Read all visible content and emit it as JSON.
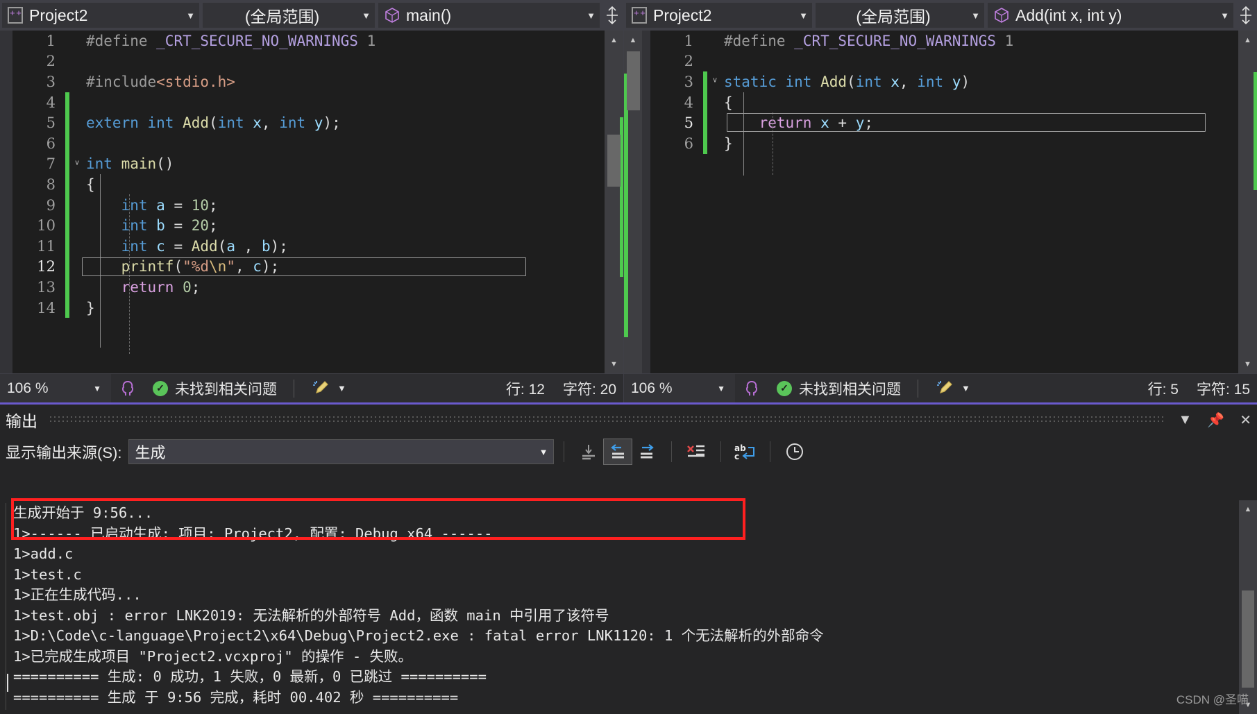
{
  "app": {
    "watermark": "CSDN @圣喵"
  },
  "editor_left": {
    "nav": {
      "project": "Project2",
      "scope": "(全局范围)",
      "function": "main()",
      "project_icon": "project-icon",
      "function_icon": "cube-icon"
    },
    "lines": [
      {
        "n": "1",
        "tokens": [
          {
            "t": "#define ",
            "c": "c-pre"
          },
          {
            "t": "_CRT_SECURE_NO_WARNINGS",
            "c": "c-macro"
          },
          {
            "t": " 1",
            "c": "c-pre"
          }
        ],
        "indent": 0
      },
      {
        "n": "2",
        "tokens": [],
        "indent": 0
      },
      {
        "n": "3",
        "tokens": [
          {
            "t": "#include",
            "c": "c-pre"
          },
          {
            "t": "<stdio.h>",
            "c": "c-hdr"
          }
        ],
        "indent": 0
      },
      {
        "n": "4",
        "tokens": [],
        "indent": 0
      },
      {
        "n": "5",
        "tokens": [
          {
            "t": "extern ",
            "c": "c-kw"
          },
          {
            "t": "int ",
            "c": "c-kw"
          },
          {
            "t": "Add",
            "c": "c-fn"
          },
          {
            "t": "(",
            "c": "c-punct"
          },
          {
            "t": "int ",
            "c": "c-kw"
          },
          {
            "t": "x",
            "c": "c-var"
          },
          {
            "t": ", ",
            "c": "c-punct"
          },
          {
            "t": "int ",
            "c": "c-kw"
          },
          {
            "t": "y",
            "c": "c-var"
          },
          {
            "t": ");",
            "c": "c-punct"
          }
        ],
        "indent": 0
      },
      {
        "n": "6",
        "tokens": [],
        "indent": 0
      },
      {
        "n": "7",
        "tokens": [
          {
            "t": "int ",
            "c": "c-kw"
          },
          {
            "t": "main",
            "c": "c-fn"
          },
          {
            "t": "()",
            "c": "c-punct"
          }
        ],
        "indent": 0
      },
      {
        "n": "8",
        "tokens": [
          {
            "t": "{",
            "c": "c-punct"
          }
        ],
        "indent": 0
      },
      {
        "n": "9",
        "tokens": [
          {
            "t": "int ",
            "c": "c-kw"
          },
          {
            "t": "a",
            "c": "c-var"
          },
          {
            "t": " = ",
            "c": "c-punct"
          },
          {
            "t": "10",
            "c": "c-num"
          },
          {
            "t": ";",
            "c": "c-punct"
          }
        ],
        "indent": 1
      },
      {
        "n": "10",
        "tokens": [
          {
            "t": "int ",
            "c": "c-kw"
          },
          {
            "t": "b",
            "c": "c-var"
          },
          {
            "t": " = ",
            "c": "c-punct"
          },
          {
            "t": "20",
            "c": "c-num"
          },
          {
            "t": ";",
            "c": "c-punct"
          }
        ],
        "indent": 1
      },
      {
        "n": "11",
        "tokens": [
          {
            "t": "int ",
            "c": "c-kw"
          },
          {
            "t": "c",
            "c": "c-var"
          },
          {
            "t": " = ",
            "c": "c-punct"
          },
          {
            "t": "Add",
            "c": "c-fn"
          },
          {
            "t": "(",
            "c": "c-punct"
          },
          {
            "t": "a",
            "c": "c-var"
          },
          {
            "t": " , ",
            "c": "c-punct"
          },
          {
            "t": "b",
            "c": "c-var"
          },
          {
            "t": ");",
            "c": "c-punct"
          }
        ],
        "indent": 1
      },
      {
        "n": "12",
        "tokens": [
          {
            "t": "printf",
            "c": "c-fn"
          },
          {
            "t": "(",
            "c": "c-punct"
          },
          {
            "t": "\"%d",
            "c": "c-str"
          },
          {
            "t": "\\n",
            "c": "c-esc"
          },
          {
            "t": "\"",
            "c": "c-str"
          },
          {
            "t": ", ",
            "c": "c-punct"
          },
          {
            "t": "c",
            "c": "c-var"
          },
          {
            "t": ");",
            "c": "c-punct"
          }
        ],
        "indent": 1
      },
      {
        "n": "13",
        "tokens": [
          {
            "t": "return ",
            "c": "c-kw2"
          },
          {
            "t": "0",
            "c": "c-num"
          },
          {
            "t": ";",
            "c": "c-punct"
          }
        ],
        "indent": 1
      },
      {
        "n": "14",
        "tokens": [
          {
            "t": "}",
            "c": "c-punct"
          }
        ],
        "indent": 0
      }
    ],
    "current_line_index": 11,
    "status": {
      "zoom": "106 %",
      "problems": "未找到相关问题",
      "line_label": "行: 12",
      "col_label": "字符: 20"
    }
  },
  "editor_right": {
    "nav": {
      "project": "Project2",
      "scope": "(全局范围)",
      "function": "Add(int x, int y)",
      "project_icon": "project-icon",
      "function_icon": "cube-icon"
    },
    "lines": [
      {
        "n": "1",
        "tokens": [
          {
            "t": "#define ",
            "c": "c-pre"
          },
          {
            "t": "_CRT_SECURE_NO_WARNINGS",
            "c": "c-macro"
          },
          {
            "t": " 1",
            "c": "c-pre"
          }
        ],
        "indent": 0
      },
      {
        "n": "2",
        "tokens": [],
        "indent": 0
      },
      {
        "n": "3",
        "tokens": [
          {
            "t": "static ",
            "c": "c-kw"
          },
          {
            "t": "int ",
            "c": "c-kw"
          },
          {
            "t": "Add",
            "c": "c-fn"
          },
          {
            "t": "(",
            "c": "c-punct"
          },
          {
            "t": "int ",
            "c": "c-kw"
          },
          {
            "t": "x",
            "c": "c-var"
          },
          {
            "t": ", ",
            "c": "c-punct"
          },
          {
            "t": "int ",
            "c": "c-kw"
          },
          {
            "t": "y",
            "c": "c-var"
          },
          {
            "t": ")",
            "c": "c-punct"
          }
        ],
        "indent": 0
      },
      {
        "n": "4",
        "tokens": [
          {
            "t": "{",
            "c": "c-punct"
          }
        ],
        "indent": 0
      },
      {
        "n": "5",
        "tokens": [
          {
            "t": "return ",
            "c": "c-kw2"
          },
          {
            "t": "x",
            "c": "c-var"
          },
          {
            "t": " + ",
            "c": "c-punct"
          },
          {
            "t": "y",
            "c": "c-var"
          },
          {
            "t": ";",
            "c": "c-punct"
          }
        ],
        "indent": 1
      },
      {
        "n": "6",
        "tokens": [
          {
            "t": "}",
            "c": "c-punct"
          }
        ],
        "indent": 0
      }
    ],
    "current_line_index": 4,
    "status": {
      "zoom": "106 %",
      "problems": "未找到相关问题",
      "line_label": "行: 5",
      "col_label": "字符: 15"
    }
  },
  "output_panel": {
    "title": "输出",
    "source_label": "显示输出来源(S):",
    "source_value": "生成",
    "toolbar_icons": [
      "jump-to-previous-icon",
      "arrow-left-icon",
      "arrow-right-icon",
      "clear-all-icon",
      "word-wrap-icon",
      "history-icon"
    ],
    "title_buttons": [
      "chevron-down-icon",
      "pin-icon",
      "close-icon"
    ],
    "lines": [
      "生成开始于 9:56...",
      "1>------ 已启动生成: 项目: Project2, 配置: Debug x64 ------",
      "1>add.c",
      "1>test.c",
      "1>正在生成代码...",
      "1>test.obj : error LNK2019: 无法解析的外部符号 Add，函数 main 中引用了该符号",
      "1>D:\\Code\\c-language\\Project2\\x64\\Debug\\Project2.exe : fatal error LNK1120: 1 个无法解析的外部命令",
      "1>已完成生成项目 \"Project2.vcxproj\" 的操作 - 失败。",
      "========== 生成: 0 成功，1 失败，0 最新，0 已跳过 ==========",
      "========== 生成 于 9:56 完成，耗时 00.402 秒 =========="
    ],
    "error_highlight_color": "#ff2020"
  },
  "colors": {
    "accent": "#6a5acd",
    "ok_green": "#5ac45a",
    "change_bar_green": "#4ec94e",
    "editor_bg": "#1e1e1e",
    "panel_bg": "#252526"
  }
}
